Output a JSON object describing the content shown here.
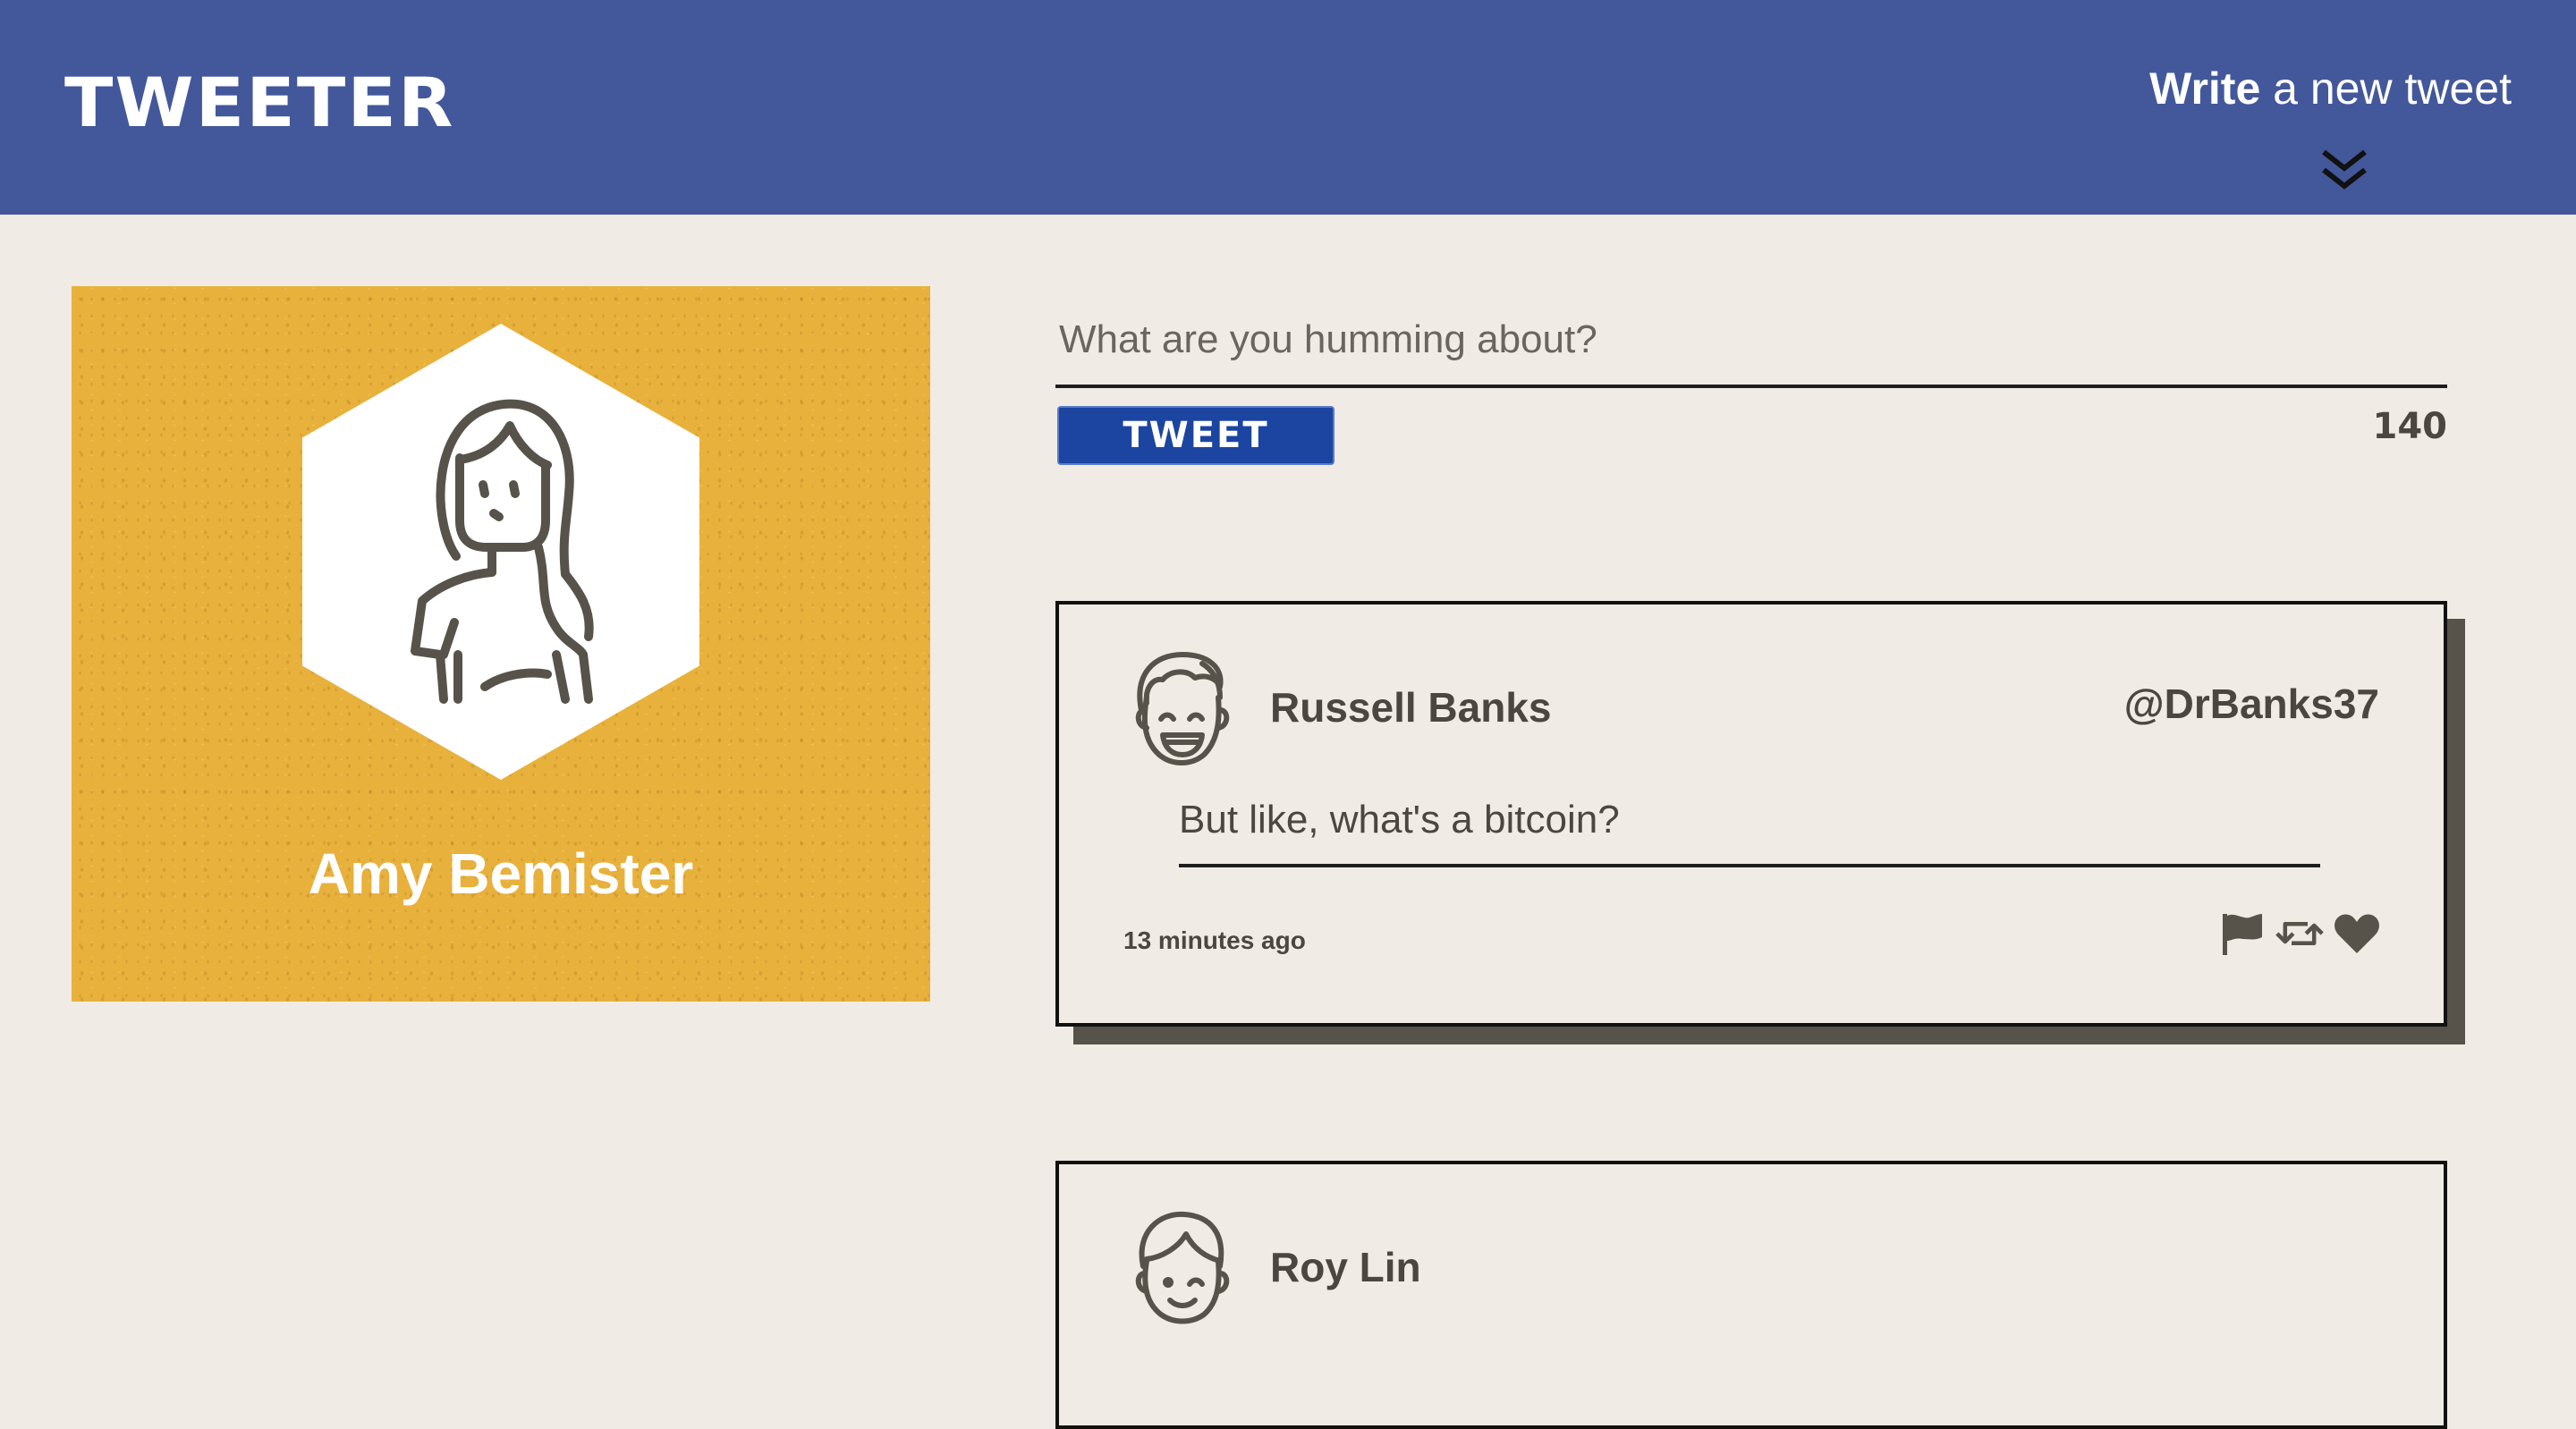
{
  "header": {
    "brand": "TWEETER",
    "compose_toggle": {
      "bold": "Write",
      "rest": " a new tweet",
      "icon": "double-chevron-down-icon"
    }
  },
  "profile": {
    "name": "Amy Bemister",
    "avatar_icon": "woman-avatar-icon"
  },
  "composer": {
    "placeholder": "What are you humming about?",
    "value": "",
    "button_label": "TWEET",
    "char_count": "140"
  },
  "tweets": [
    {
      "author": "Russell Banks",
      "handle": "@DrBanks37",
      "avatar_icon": "laughing-man-avatar-icon",
      "text": "But like, what's a bitcoin?",
      "time": "13 minutes ago",
      "actions": [
        "flag-icon",
        "retweet-icon",
        "heart-icon"
      ]
    },
    {
      "author": "Roy Lin",
      "handle": "",
      "avatar_icon": "winking-man-avatar-icon",
      "text": "",
      "time": "",
      "actions": []
    }
  ],
  "colors": {
    "header_bg": "#43579b",
    "page_bg": "#f0ebe4",
    "profile_bg": "#e8b13c",
    "button_bg": "#1b45a0",
    "text": "#4a4740",
    "shadow": "#57534a"
  }
}
